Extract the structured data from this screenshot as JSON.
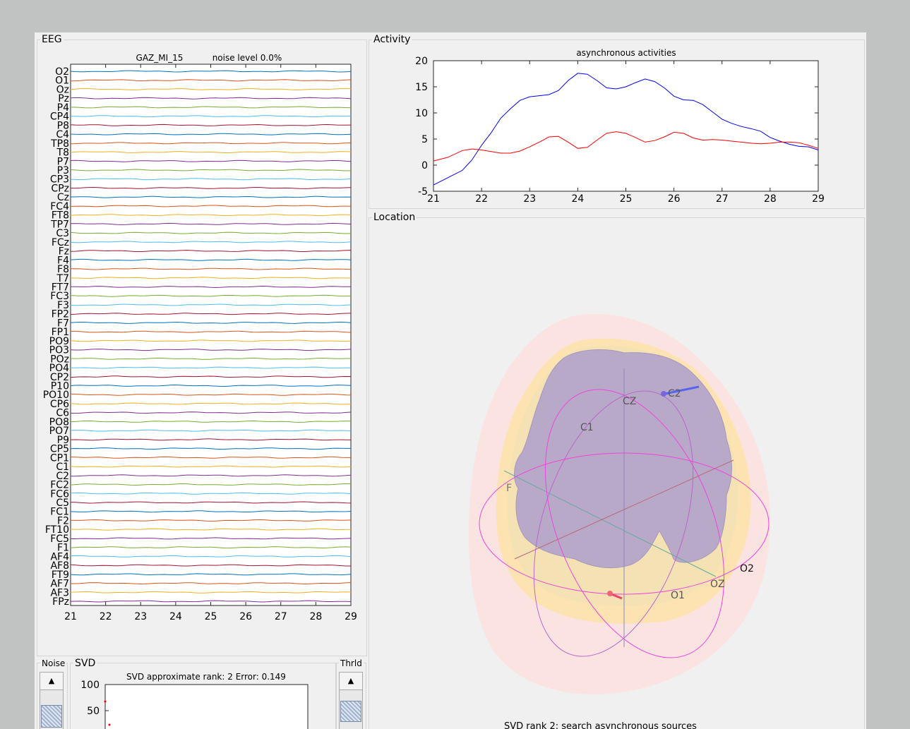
{
  "panels": {
    "eeg": "EEG",
    "activity": "Activity",
    "location": "Location",
    "noise": "Noise",
    "svd": "SVD",
    "threshold": "Thrld"
  },
  "eeg_plot": {
    "subject": "GAZ_MI_15",
    "noise_label": "noise level  0.0%",
    "channels": [
      "O2",
      "O1",
      "Oz",
      "Pz",
      "P4",
      "CP4",
      "P8",
      "C4",
      "TP8",
      "T8",
      "P7",
      "P3",
      "CP3",
      "CPz",
      "Cz",
      "FC4",
      "FT8",
      "TP7",
      "C3",
      "FCz",
      "Fz",
      "F4",
      "F8",
      "T7",
      "FT7",
      "FC3",
      "F3",
      "FP2",
      "F7",
      "FP1",
      "PO9",
      "PO3",
      "POz",
      "PO4",
      "CP2",
      "P10",
      "PO10",
      "CP6",
      "C6",
      "PO8",
      "PO7",
      "P9",
      "CP5",
      "CP1",
      "C1",
      "C2",
      "FC2",
      "FC6",
      "C5",
      "FC1",
      "F2",
      "FT10",
      "FC5",
      "F1",
      "AF4",
      "AF8",
      "FT9",
      "AF7",
      "AF3",
      "FPz"
    ],
    "x_ticks": [
      "21",
      "22",
      "23",
      "24",
      "25",
      "26",
      "27",
      "28",
      "29"
    ],
    "colors": [
      "#0072bd",
      "#d95319",
      "#edb120",
      "#7e2f8e",
      "#77ac30",
      "#4dbeee",
      "#a2142f"
    ]
  },
  "chart_data": {
    "type": "line",
    "title": "asynchronous activities",
    "xlim": [
      21,
      29
    ],
    "ylim": [
      -5,
      20
    ],
    "x_ticks": [
      "21",
      "22",
      "23",
      "24",
      "25",
      "26",
      "27",
      "28",
      "29"
    ],
    "y_ticks": [
      "20",
      "15",
      "10",
      "5",
      "0",
      "-5"
    ],
    "series": [
      {
        "color": "#0000ff",
        "x": [
          21,
          21.3,
          21.6,
          21.8,
          22,
          22.2,
          22.4,
          22.6,
          22.8,
          23,
          23.2,
          23.4,
          23.6,
          23.8,
          24,
          24.2,
          24.4,
          24.6,
          24.8,
          25,
          25.2,
          25.4,
          25.6,
          25.8,
          26,
          26.2,
          26.4,
          26.6,
          26.8,
          27,
          27.2,
          27.4,
          27.6,
          27.8,
          28,
          28.2,
          28.4,
          28.6,
          28.8,
          29
        ],
        "values": [
          -3.8,
          -2.4,
          -1.0,
          1.0,
          3.8,
          6.2,
          9.0,
          10.8,
          12.4,
          13.1,
          13.3,
          13.5,
          14.3,
          16.2,
          17.6,
          17.4,
          16.2,
          14.8,
          14.6,
          15.0,
          15.8,
          16.5,
          16.0,
          14.8,
          13.2,
          12.5,
          12.4,
          11.6,
          10.2,
          8.8,
          8.0,
          7.4,
          7.0,
          6.5,
          5.3,
          4.6,
          4.0,
          3.6,
          3.5,
          2.9
        ]
      },
      {
        "color": "#ff0000",
        "x": [
          21,
          21.3,
          21.6,
          21.8,
          22,
          22.2,
          22.4,
          22.6,
          22.8,
          23,
          23.2,
          23.4,
          23.6,
          23.8,
          24,
          24.2,
          24.4,
          24.6,
          24.8,
          25,
          25.2,
          25.4,
          25.6,
          25.8,
          26,
          26.2,
          26.4,
          26.6,
          26.8,
          27,
          27.2,
          27.4,
          27.6,
          27.8,
          28,
          28.2,
          28.4,
          28.6,
          28.8,
          29
        ],
        "values": [
          0.8,
          1.5,
          2.8,
          3.1,
          2.9,
          2.6,
          2.3,
          2.3,
          2.7,
          3.5,
          4.4,
          5.4,
          5.5,
          4.4,
          3.2,
          3.4,
          4.8,
          6.1,
          6.4,
          6.1,
          5.3,
          4.4,
          4.7,
          5.4,
          6.3,
          6.1,
          5.2,
          4.8,
          4.9,
          4.8,
          4.6,
          4.4,
          4.2,
          4.1,
          4.2,
          4.4,
          4.4,
          4.3,
          3.8,
          3.2
        ]
      }
    ]
  },
  "location": {
    "labels": [
      "C2",
      "CZ",
      "C1",
      "O2",
      "OZ",
      "O1"
    ],
    "partial_label": "F",
    "caption": "SVD rank 2: search asynchronous sources"
  },
  "svd_plot": {
    "title": "SVD approximate rank: 2   Error: 0.149",
    "y_ticks": [
      "100",
      "50"
    ]
  }
}
